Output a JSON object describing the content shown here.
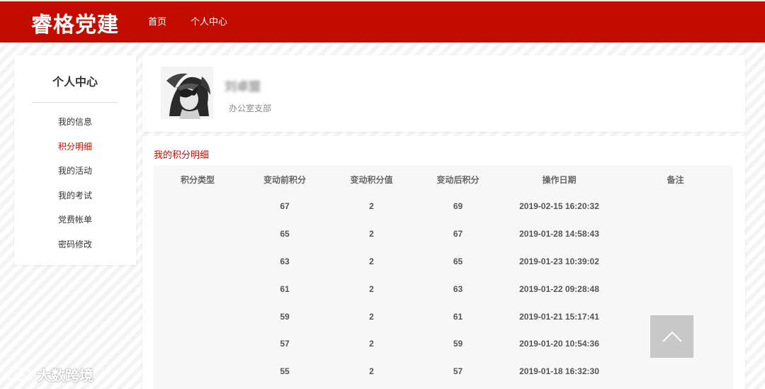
{
  "header": {
    "logo": "睿格党建",
    "nav": [
      "首页",
      "个人中心"
    ]
  },
  "sidebar": {
    "title": "个人中心",
    "items": [
      {
        "label": "我的信息",
        "active": false
      },
      {
        "label": "积分明细",
        "active": true
      },
      {
        "label": "我的活动",
        "active": false
      },
      {
        "label": "我的考试",
        "active": false
      },
      {
        "label": "党费帐单",
        "active": false
      },
      {
        "label": "密码修改",
        "active": false
      }
    ]
  },
  "profile": {
    "name": "刘卓盟",
    "department": "办公室支部"
  },
  "points": {
    "section_title": "我的积分明细",
    "columns": [
      "积分类型",
      "变动前积分",
      "变动积分值",
      "变动后积分",
      "操作日期",
      "备注"
    ],
    "rows": [
      [
        "",
        "67",
        "2",
        "69",
        "2019-02-15 16:20:32",
        ""
      ],
      [
        "",
        "65",
        "2",
        "67",
        "2019-01-28 14:58:43",
        ""
      ],
      [
        "",
        "63",
        "2",
        "65",
        "2019-01-23 10:39:02",
        ""
      ],
      [
        "",
        "61",
        "2",
        "63",
        "2019-01-22 09:28:48",
        ""
      ],
      [
        "",
        "59",
        "2",
        "61",
        "2019-01-21 15:17:41",
        ""
      ],
      [
        "",
        "57",
        "2",
        "59",
        "2019-01-20 10:54:36",
        ""
      ],
      [
        "",
        "55",
        "2",
        "57",
        "2019-01-18 16:32:30",
        ""
      ]
    ]
  },
  "watermark": "大数跨境",
  "colors": {
    "brand": "#c20c00",
    "back_to_top": "#c8c8c8"
  },
  "icons": {
    "back_to_top": "chevron-up-icon",
    "watermark_logo": "cloud-logo-icon"
  }
}
